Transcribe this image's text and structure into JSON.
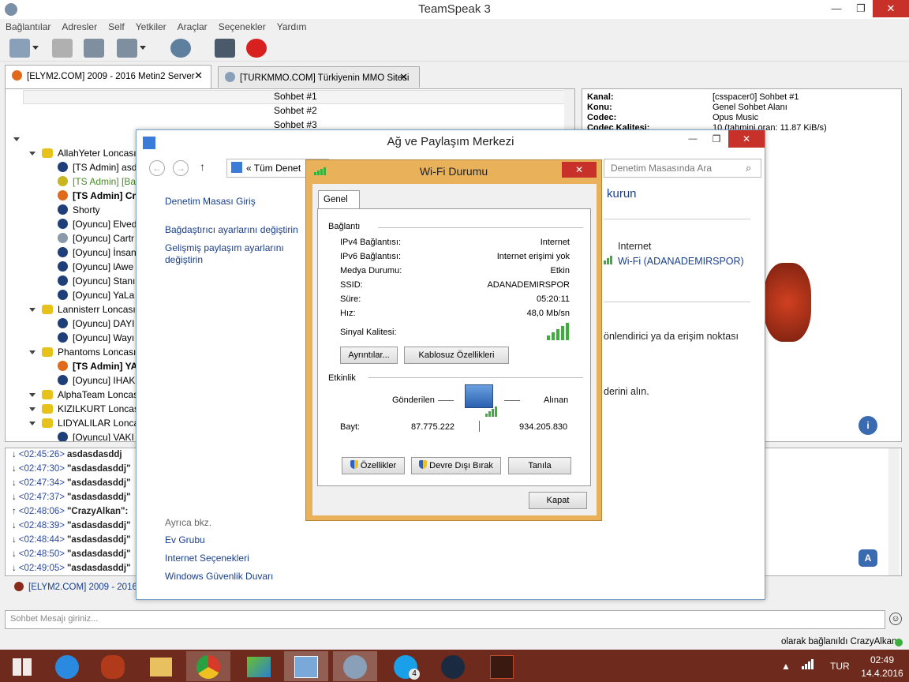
{
  "app": {
    "title": "TeamSpeak 3"
  },
  "window_buttons": {
    "minimize": "—",
    "maximize": "❐",
    "close": "✕"
  },
  "menu": [
    "Bağlantılar",
    "Adresler",
    "Self",
    "Yetkiler",
    "Araçlar",
    "Seçenekler",
    "Yardım"
  ],
  "tabs": [
    {
      "label": "[ELYM2.COM] 2009 - 2016 Metin2 Server",
      "close": "✕"
    },
    {
      "label": "[TURKMMO.COM] Türkiyenin MMO Sitesi",
      "close": "✕"
    }
  ],
  "tree": {
    "channels_top": [
      "Sohbet #1",
      "Sohbet #2",
      "Sohbet #3"
    ],
    "groups": [
      {
        "name": "AllahYeter Loncası",
        "users": [
          {
            "name": "[TS Admin] asd",
            "status": "blue"
          },
          {
            "name": "[TS Admin] [Ba",
            "status": "yellow"
          },
          {
            "name": "[TS Admin] Cra",
            "status": "orange"
          },
          {
            "name": "Shorty",
            "status": "blue"
          },
          {
            "name": "[Oyuncu] Elved",
            "status": "blue"
          },
          {
            "name": "[Oyuncu] Cartr",
            "status": "muted"
          },
          {
            "name": "[Oyuncu] İnsan",
            "status": "blue"
          },
          {
            "name": "[Oyuncu] lAwe",
            "status": "blue"
          },
          {
            "name": "[Oyuncu] Stanı",
            "status": "blue"
          },
          {
            "name": "[Oyuncu] YaLa",
            "status": "blue"
          }
        ]
      },
      {
        "name": "Lannisterr Loncası",
        "users": [
          {
            "name": "[Oyuncu] DAYI",
            "status": "blue"
          },
          {
            "name": "[Oyuncu] Wayı",
            "status": "blue"
          }
        ]
      },
      {
        "name": "Phantoms Loncası",
        "users": [
          {
            "name": "[TS Admin] YA",
            "status": "orange"
          },
          {
            "name": "[Oyuncu] IHAK",
            "status": "blue"
          }
        ]
      },
      {
        "name": "AlphaTeam Loncas",
        "users": []
      },
      {
        "name": "KIZILKURT Loncası",
        "users": []
      },
      {
        "name": "LIDYALILAR Lonca",
        "users": [
          {
            "name": "[Oyuncu] VAKI",
            "status": "blue"
          }
        ]
      }
    ]
  },
  "info": {
    "rows": [
      {
        "k": "Kanal:",
        "v": "[csspacer0] Sohbet #1"
      },
      {
        "k": "Konu:",
        "v": "Genel Sohbet Alanı"
      },
      {
        "k": "Codec:",
        "v": "Opus Music"
      },
      {
        "k": "Codec Kalitesi:",
        "v": "10 (tahmini oran: 11.87 KiB/s)"
      }
    ]
  },
  "chatlog": [
    {
      "arrow": "↓",
      "time": "<02:45:26>",
      "name": "asdasdasddj"
    },
    {
      "arrow": "↓",
      "time": "<02:47:30>",
      "name": "\"asdasdasddj\""
    },
    {
      "arrow": "↓",
      "time": "<02:47:34>",
      "name": "\"asdasdasddj\""
    },
    {
      "arrow": "↓",
      "time": "<02:47:37>",
      "name": "\"asdasdasddj\""
    },
    {
      "arrow": "↑",
      "time": "<02:48:06>",
      "name": "\"CrazyAlkan\":"
    },
    {
      "arrow": "↓",
      "time": "<02:48:39>",
      "name": "\"asdasdasddj\""
    },
    {
      "arrow": "↓",
      "time": "<02:48:44>",
      "name": "\"asdasdasddj\""
    },
    {
      "arrow": "↓",
      "time": "<02:48:50>",
      "name": "\"asdasdasddj\""
    },
    {
      "arrow": "↓",
      "time": "<02:49:05>",
      "name": "\"asdasdasddj\""
    }
  ],
  "server_bar": {
    "label": "[ELYM2.COM] 2009 - 2016 M"
  },
  "chat_input": {
    "placeholder": "Sohbet Mesajı giriniz..."
  },
  "status": {
    "text": "olarak bağlanıldı CrazyAlkan"
  },
  "netwin": {
    "title": "Ağ ve Paylaşım Merkezi",
    "address": "«  Tüm Denet",
    "search": "Denetim Masasında Ara",
    "left_links": [
      "Denetim Masası Giriş",
      "Bağdaştırıcı ayarlarını değiştirin",
      "Gelişmiş paylaşım ayarlarını",
      "değiştirin"
    ],
    "see_also": "Ayrıca bkz.",
    "bottom_links": [
      "Ev Grubu",
      "Internet Seçenekleri",
      "Windows Güvenlik Duvarı"
    ],
    "right_frag_1": "kurun",
    "right_internet": "Internet",
    "right_wifi": "Wi-Fi (ADANADEMIRSPOR)",
    "right_frag_2": "önlendirici ya da erişim noktası",
    "right_frag_3": "derini alın."
  },
  "wifi": {
    "title": "Wi-Fi Durumu",
    "close": "✕",
    "tab": "Genel",
    "section_conn": "Bağlantı",
    "rows": [
      {
        "k": "IPv4 Bağlantısı:",
        "v": "Internet"
      },
      {
        "k": "IPv6 Bağlantısı:",
        "v": "Internet erişimi yok"
      },
      {
        "k": "Medya Durumu:",
        "v": "Etkin"
      },
      {
        "k": "SSID:",
        "v": "ADANADEMIRSPOR"
      },
      {
        "k": "Süre:",
        "v": "05:20:11"
      },
      {
        "k": "Hız:",
        "v": "48,0 Mb/sn"
      }
    ],
    "signal_label": "Sinyal Kalitesi:",
    "signal_bars": 5,
    "btn_details": "Ayrıntılar...",
    "btn_wireless": "Kablosuz Özellikleri",
    "section_activity": "Etkinlik",
    "sent_label": "Gönderilen",
    "recv_label": "Alınan",
    "bytes_label": "Bayt:",
    "sent_bytes": "87.775.222",
    "recv_bytes": "934.205.830",
    "btn_props": "Özellikler",
    "btn_disable": "Devre Dışı Bırak",
    "btn_diagnose": "Tanıla",
    "btn_close": "Kapat"
  },
  "taskbar": {
    "lang": "TUR",
    "time": "02:49",
    "date": "14.4.2016",
    "skype_badge": "4"
  },
  "colors": {
    "accent_orange": "#e8b15a",
    "close_red": "#c7312a",
    "taskbar": "#6e2a1c",
    "link_blue": "#1a3f8a"
  }
}
